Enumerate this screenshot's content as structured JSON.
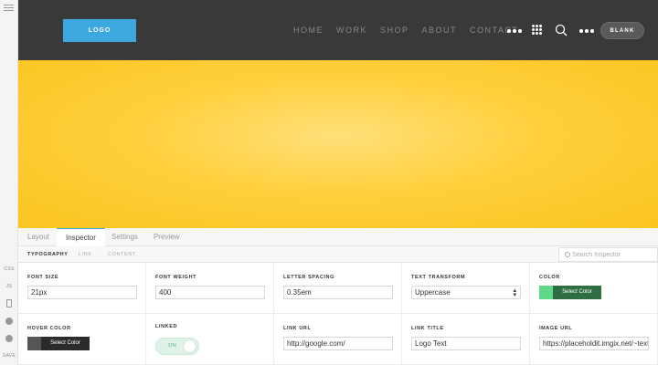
{
  "sidebar": {
    "items": [
      {
        "label": "CSS",
        "icon": "css-label"
      },
      {
        "label": "JS",
        "icon": "js-label"
      },
      {
        "label": "",
        "icon": "device-icon"
      },
      {
        "label": "",
        "icon": "settings-icon"
      },
      {
        "label": "",
        "icon": "help-icon"
      },
      {
        "label": "SAVE",
        "icon": "save-label"
      }
    ]
  },
  "header": {
    "logo": "LOGO",
    "nav": [
      "HOME",
      "WORK",
      "SHOP",
      "ABOUT",
      "CONTACT"
    ],
    "button": "BLANK",
    "colors": {
      "bar": "#393939",
      "logo": "#3da7e0"
    }
  },
  "hero": {
    "color": "#ffcf3c"
  },
  "tabs": {
    "items": [
      "Layout",
      "Inspector",
      "Settings",
      "Preview"
    ],
    "active": "Inspector"
  },
  "subtabs": {
    "items": [
      "TYPOGRAPHY",
      "LINK",
      "CONTENT"
    ],
    "active": "TYPOGRAPHY"
  },
  "search": {
    "placeholder": "Search Inspector"
  },
  "props": {
    "font_size": {
      "label": "FONT SIZE",
      "value": "21px"
    },
    "font_weight": {
      "label": "FONT WEIGHT",
      "value": "400"
    },
    "letter_spacing": {
      "label": "LETTER SPACING",
      "value": "0.35em"
    },
    "text_transform": {
      "label": "TEXT TRANSFORM",
      "value": "Uppercase"
    },
    "color": {
      "label": "COLOR",
      "button": "Select Color",
      "swatch": "#5fd88a",
      "bg": "#2f6e43"
    },
    "hover_color": {
      "label": "HOVER COLOR",
      "button": "Select Color",
      "swatch": "#555555",
      "bg": "#2b2b2b"
    },
    "linked": {
      "label": "LINKED",
      "state": "ON"
    },
    "link_url": {
      "label": "LINK URL",
      "value": "http://google.com/"
    },
    "link_title": {
      "label": "LINK TITLE",
      "value": "Logo Text"
    },
    "image_url": {
      "label": "IMAGE URL",
      "value": "https://placeholdit.imgix.net/~text?"
    }
  }
}
